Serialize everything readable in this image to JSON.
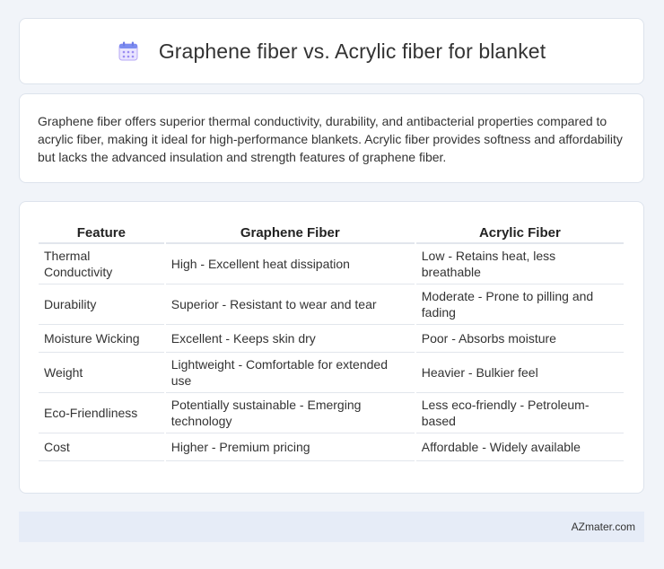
{
  "header": {
    "title": "Graphene fiber vs. Acrylic fiber for blanket",
    "icon": "calendar-icon",
    "icon_color": "#8e7cf0"
  },
  "summary": {
    "text": "Graphene fiber offers superior thermal conductivity, durability, and antibacterial properties compared to acrylic fiber, making it ideal for high-performance blankets. Acrylic fiber provides softness and affordability but lacks the advanced insulation and strength features of graphene fiber."
  },
  "table": {
    "headers": [
      "Feature",
      "Graphene Fiber",
      "Acrylic Fiber"
    ],
    "rows": [
      [
        "Thermal Conductivity",
        "High - Excellent heat dissipation",
        "Low - Retains heat, less breathable"
      ],
      [
        "Durability",
        "Superior - Resistant to wear and tear",
        "Moderate - Prone to pilling and fading"
      ],
      [
        "Moisture Wicking",
        "Excellent - Keeps skin dry",
        "Poor - Absorbs moisture"
      ],
      [
        "Weight",
        "Lightweight - Comfortable for extended use",
        "Heavier - Bulkier feel"
      ],
      [
        "Eco-Friendliness",
        "Potentially sustainable - Emerging technology",
        "Less eco-friendly - Petroleum-based"
      ],
      [
        "Cost",
        "Higher - Premium pricing",
        "Affordable - Widely available"
      ]
    ]
  },
  "footer": {
    "text": "AZmater.com"
  }
}
